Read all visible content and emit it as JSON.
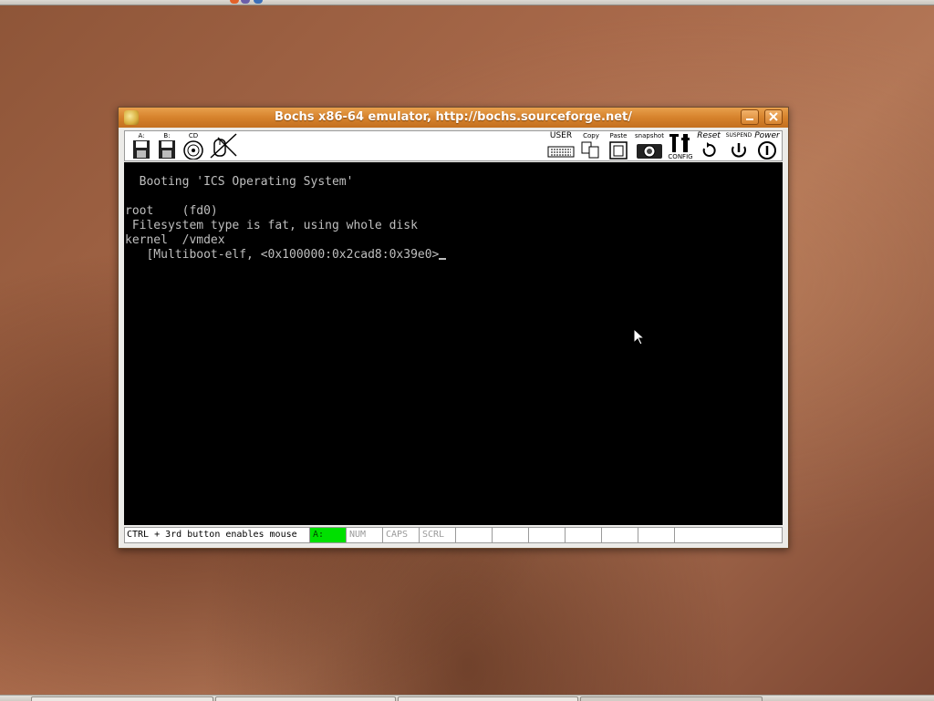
{
  "colors": {
    "titlebar": "#d6822c",
    "screen_bg": "#000000",
    "screen_text": "#bfbfbf",
    "led_on": "#00e000"
  },
  "window": {
    "title": "Bochs x86-64 emulator, http://bochs.sourceforge.net/",
    "title_icon": "bochs-icon",
    "minimize_icon": "minimize-icon",
    "close_icon": "close-icon"
  },
  "toolbar": {
    "left": [
      {
        "id": "floppy-a",
        "label": "A:",
        "icon": "floppy-a-icon"
      },
      {
        "id": "floppy-b",
        "label": "B:",
        "icon": "floppy-b-icon"
      },
      {
        "id": "cdrom",
        "label": "CD",
        "icon": "cdrom-icon"
      },
      {
        "id": "mouse",
        "label": "",
        "icon": "mouse-disabled-icon"
      }
    ],
    "right": [
      {
        "id": "user",
        "label": "USER",
        "icon": "keyboard-icon"
      },
      {
        "id": "copy",
        "label": "Copy",
        "icon": "copy-icon"
      },
      {
        "id": "paste",
        "label": "Paste",
        "icon": "paste-icon"
      },
      {
        "id": "snapshot",
        "label": "snapshot",
        "icon": "camera-icon"
      },
      {
        "id": "config",
        "label": "CONFIG",
        "icon": "config-icon"
      },
      {
        "id": "reset",
        "label": "Reset",
        "icon": "reset-icon"
      },
      {
        "id": "suspend",
        "label": "SUSPEND",
        "icon": "suspend-icon"
      },
      {
        "id": "power",
        "label": "Power",
        "icon": "power-icon"
      }
    ]
  },
  "screen": {
    "lines": [
      "  Booting 'ICS Operating System'",
      "",
      "root    (fd0)",
      " Filesystem type is fat, using whole disk",
      "kernel  /vmdex",
      "   [Multiboot-elf, <0x100000:0x2cad8:0x39e0>"
    ]
  },
  "statusbar": {
    "message": "CTRL + 3rd button enables mouse",
    "leds": [
      {
        "label": "A:",
        "on": true
      },
      {
        "label": "NUM",
        "on": false
      },
      {
        "label": "CAPS",
        "on": false
      },
      {
        "label": "SCRL",
        "on": false
      },
      {
        "label": "",
        "on": false
      },
      {
        "label": "",
        "on": false
      },
      {
        "label": "",
        "on": false
      },
      {
        "label": "",
        "on": false
      },
      {
        "label": "",
        "on": false
      },
      {
        "label": "",
        "on": false
      }
    ]
  }
}
